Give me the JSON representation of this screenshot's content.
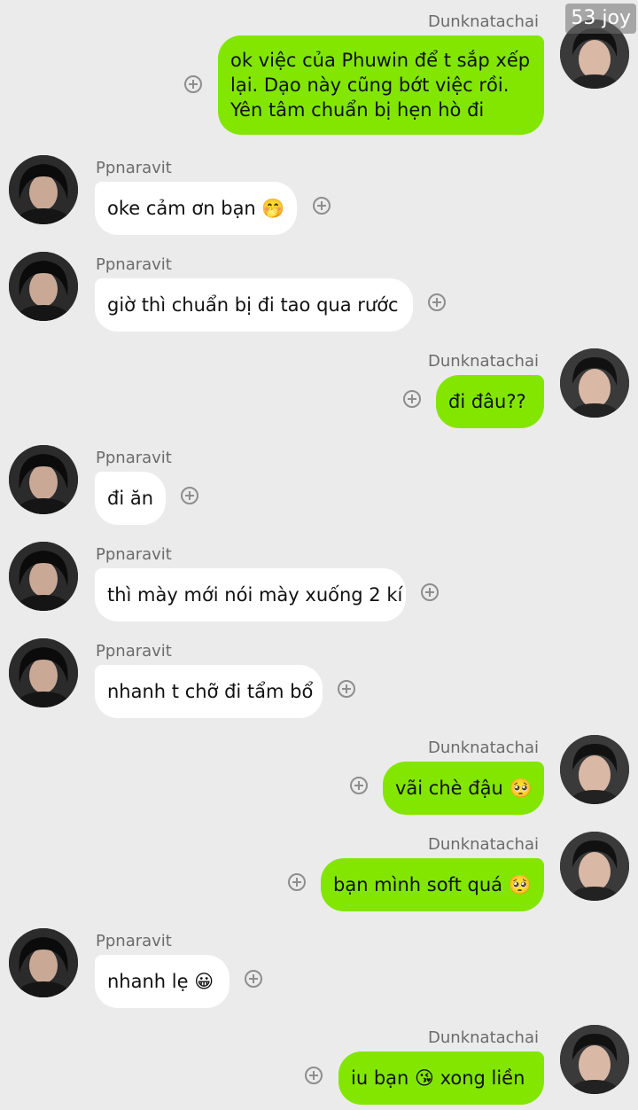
{
  "story_badge": "53 joy",
  "users": {
    "self": "Dunknatachai",
    "other": "Ppnaravit"
  },
  "messages": [
    {
      "side": "right",
      "sender": "Dunknatachai",
      "lines": [
        "ok việc của Phuwin để t sắp xếp",
        "lại. Dạo này cũng bớt việc rồi.",
        "Yên tâm chuẩn bị hẹn hò đi"
      ]
    },
    {
      "side": "left",
      "sender": "Ppnaravit",
      "text": "oke cảm ơn bạn 🤭"
    },
    {
      "side": "left",
      "sender": "Ppnaravit",
      "text": "giờ thì chuẩn bị đi tao qua rước"
    },
    {
      "side": "right",
      "sender": "Dunknatachai",
      "text": "đi đâu??"
    },
    {
      "side": "left",
      "sender": "Ppnaravit",
      "text": "đi ăn"
    },
    {
      "side": "left",
      "sender": "Ppnaravit",
      "text": "thì mày mới nói mày xuống 2 kí"
    },
    {
      "side": "left",
      "sender": "Ppnaravit",
      "text": "nhanh t chỡ đi tẩm bổ"
    },
    {
      "side": "right",
      "sender": "Dunknatachai",
      "text": "vãi chè đậu 🥺"
    },
    {
      "side": "right",
      "sender": "Dunknatachai",
      "text": "bạn mình soft quá 🥺"
    },
    {
      "side": "left",
      "sender": "Ppnaravit",
      "text": "nhanh lẹ 😀"
    },
    {
      "side": "right",
      "sender": "Dunknatachai",
      "text": "iu bạn 😘 xong liền"
    }
  ],
  "colors": {
    "background": "#ebebeb",
    "self_bubble": "#82e600",
    "other_bubble": "#ffffff",
    "sender_text": "#6b6b6b"
  },
  "icons": {
    "add_reaction": "plus-circle-icon"
  }
}
